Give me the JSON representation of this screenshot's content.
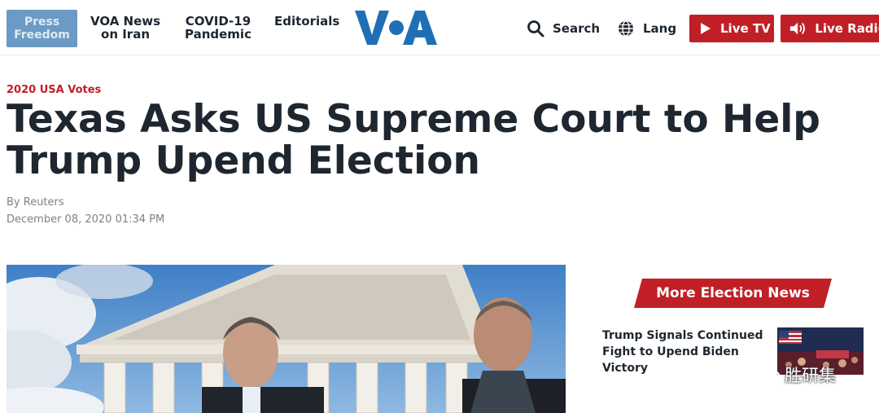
{
  "nav": {
    "badge_line1": "Press",
    "badge_line2": "Freedom",
    "links": [
      {
        "line1": "VOA News",
        "line2": "on Iran"
      },
      {
        "line1": "COVID-19",
        "line2": "Pandemic"
      },
      {
        "line1": "Editorials",
        "line2": ""
      }
    ],
    "logo_text": "VOA",
    "search_label": "Search",
    "lang_label": "Lang",
    "live_tv_label": "Live TV",
    "live_radio_label": "Live Radio"
  },
  "article": {
    "kicker": "2020 USA Votes",
    "headline": "Texas Asks US Supreme Court to Help Trump Upend Election",
    "byline": "By Reuters",
    "date": "December 08, 2020 01:34 PM"
  },
  "sidebar": {
    "section_title": "More Election News",
    "story_title": "Trump Signals Continued Fight to Upend Biden Victory"
  },
  "watermark": {
    "text": "胜研集"
  },
  "colors": {
    "brand_red": "#c11f26",
    "brand_blue": "#1f6fb5",
    "badge_blue": "#6b9ac4",
    "text_dark": "#1e2630",
    "meta_gray": "#7a828a"
  }
}
